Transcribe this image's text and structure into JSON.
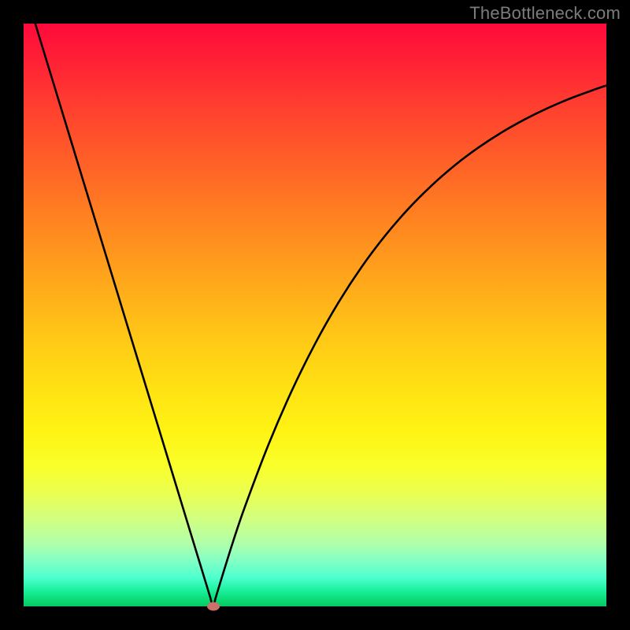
{
  "watermark": "TheBottleneck.com",
  "chart_data": {
    "type": "line",
    "title": "",
    "xlabel": "",
    "ylabel": "",
    "xlim": [
      0,
      1
    ],
    "ylim": [
      0,
      1
    ],
    "grid": false,
    "series": [
      {
        "name": "bottleneck-curve",
        "x": [
          0.02,
          0.06,
          0.1,
          0.14,
          0.18,
          0.22,
          0.26,
          0.28,
          0.3,
          0.31,
          0.32,
          0.325,
          0.33,
          0.34,
          0.36,
          0.38,
          0.42,
          0.46,
          0.5,
          0.54,
          0.58,
          0.62,
          0.66,
          0.7,
          0.74,
          0.78,
          0.82,
          0.86,
          0.9,
          0.94,
          0.98,
          1.0
        ],
        "y": [
          1.0,
          0.8689,
          0.7377,
          0.6066,
          0.4754,
          0.3443,
          0.2131,
          0.1475,
          0.082,
          0.0492,
          0.0164,
          0.0,
          0.0164,
          0.0492,
          0.113,
          0.1717,
          0.2772,
          0.3697,
          0.4504,
          0.521,
          0.5824,
          0.6357,
          0.682,
          0.7221,
          0.7569,
          0.787,
          0.8131,
          0.8357,
          0.8553,
          0.8723,
          0.887,
          0.8938
        ]
      }
    ],
    "marker": {
      "x": 0.325,
      "y": 0.0
    },
    "background_gradient": {
      "top": "#ff0a3a",
      "mid": "#ffd815",
      "bottom": "#07c85f"
    }
  }
}
